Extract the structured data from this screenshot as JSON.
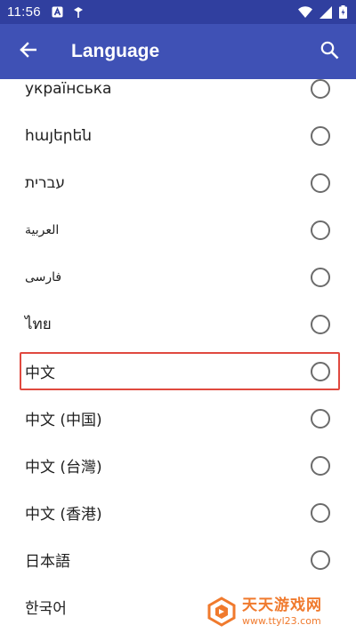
{
  "status_bar": {
    "time": "11:56",
    "left_icons": [
      "a-badge-icon",
      "pinwheel-icon"
    ],
    "right_icons": [
      "wifi-icon",
      "signal-icon",
      "battery-icon"
    ]
  },
  "app_bar": {
    "title": "Language",
    "background": "#3f51b5",
    "status_background": "#303f9f"
  },
  "languages": [
    {
      "label": "українська",
      "selected": false
    },
    {
      "label": "հայերեն",
      "selected": false
    },
    {
      "label": "עברית",
      "selected": false
    },
    {
      "label": "العربية",
      "selected": false
    },
    {
      "label": "فارسی",
      "selected": false
    },
    {
      "label": "ไทย",
      "selected": false
    },
    {
      "label": "中文",
      "selected": false,
      "highlighted": true
    },
    {
      "label": "中文 (中国)",
      "selected": false
    },
    {
      "label": "中文 (台灣)",
      "selected": false
    },
    {
      "label": "中文 (香港)",
      "selected": false
    },
    {
      "label": "日本語",
      "selected": false
    },
    {
      "label": "한국어",
      "selected": false
    }
  ],
  "highlight_color": "#e0493f",
  "watermark": {
    "main": "天天游戏网",
    "url": "www.ttyl23.com"
  }
}
